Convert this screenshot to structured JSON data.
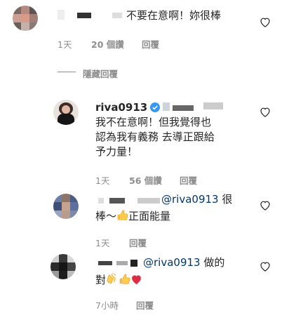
{
  "comments": [
    {
      "text": "不要在意啊！妳很棒",
      "time": "1天",
      "likes": "20 個讚",
      "reply": "回覆"
    },
    {
      "toggle": "隱藏回覆"
    },
    {
      "username": "riva0913",
      "text_line1": "我不在意啊！但我覺得也",
      "text_line2": "認為我有義務 去導正跟給",
      "text_line3": "予力量！",
      "time": "1天",
      "likes": "56 個讚",
      "reply": "回覆"
    },
    {
      "mention": "@riva0913",
      "text_a": "很",
      "text_b": "棒～",
      "text_c": "正面能量",
      "time": "1天",
      "reply": "回覆"
    },
    {
      "mention": "@riva0913",
      "text_a": "做的",
      "text_b": "對",
      "time": "7小時",
      "reply": "回覆"
    }
  ],
  "icons": {
    "heart": "heart-outline-icon",
    "verified": "verified-badge-icon",
    "thumbs_up": "thumbs-up-emoji",
    "clap": "clapping-hands-emoji",
    "red_heart": "red-heart-emoji"
  },
  "colors": {
    "text": "#262626",
    "meta": "#8e8e8e",
    "mention": "#00376b",
    "verified": "#3897f0"
  }
}
